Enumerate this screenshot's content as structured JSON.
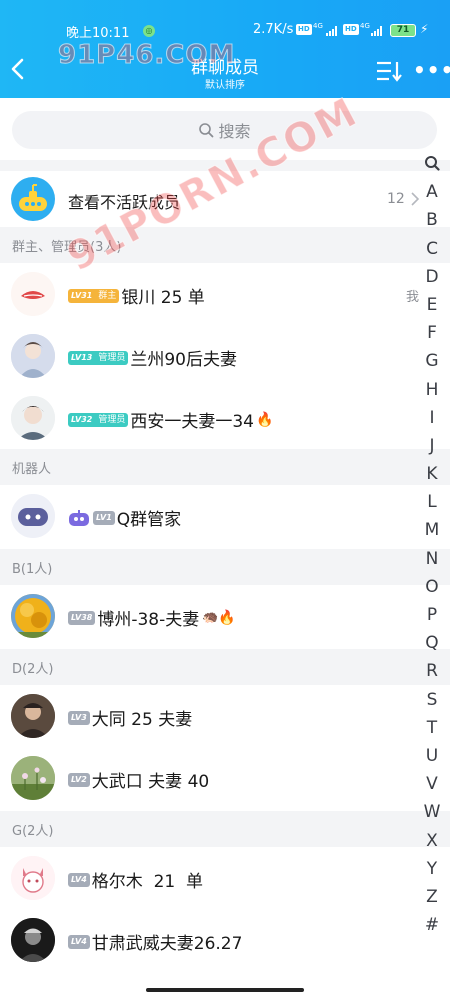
{
  "status_bar": {
    "time": "晚上10:11",
    "speed": "2.7K/s",
    "hd1": "HD",
    "net1": "4G",
    "hd2": "HD",
    "net2": "4G",
    "battery": "71"
  },
  "header": {
    "title": "群聊成员",
    "subtitle": "默认排序"
  },
  "search": {
    "placeholder": "搜索"
  },
  "inactive": {
    "label": "查看不活跃成员",
    "count": "12"
  },
  "sections": [
    {
      "label": "群主、管理员(3人)",
      "members": [
        {
          "lv": "LV31",
          "role": "群主",
          "name": "银川 25 单",
          "tag": "我"
        },
        {
          "lv": "LV13",
          "role": "管理员",
          "name": "兰州90后夫妻"
        },
        {
          "lv": "LV32",
          "role": "管理员",
          "name": "西安一夫妻一34"
        }
      ]
    },
    {
      "label": "机器人",
      "members": [
        {
          "lv": "LV1",
          "name": "Q群管家"
        }
      ]
    },
    {
      "label": "B(1人)",
      "members": [
        {
          "lv": "LV38",
          "name": "博州-38-夫妻"
        }
      ]
    },
    {
      "label": "D(2人)",
      "members": [
        {
          "lv": "LV3",
          "name": "大同 25 夫妻"
        },
        {
          "lv": "LV2",
          "name": "大武口 夫妻 40"
        }
      ]
    },
    {
      "label": "G(2人)",
      "members": [
        {
          "lv": "LV4",
          "name": "格尔木  21  单"
        },
        {
          "lv": "LV4",
          "name": "甘肃武威夫妻26.27"
        }
      ]
    }
  ],
  "index_letters": [
    "A",
    "B",
    "C",
    "D",
    "E",
    "F",
    "G",
    "H",
    "I",
    "J",
    "K",
    "L",
    "M",
    "N",
    "O",
    "P",
    "Q",
    "R",
    "S",
    "T",
    "U",
    "V",
    "W",
    "X",
    "Y",
    "Z",
    "#"
  ],
  "watermarks": {
    "top": "91P46.COM",
    "diag": "91PORN.COM"
  },
  "colors": {
    "header": "#1aa9f6",
    "owner_badge": "#f5b43b",
    "admin_badge": "#3ccbc2",
    "level_badge": "#a5acb8"
  }
}
